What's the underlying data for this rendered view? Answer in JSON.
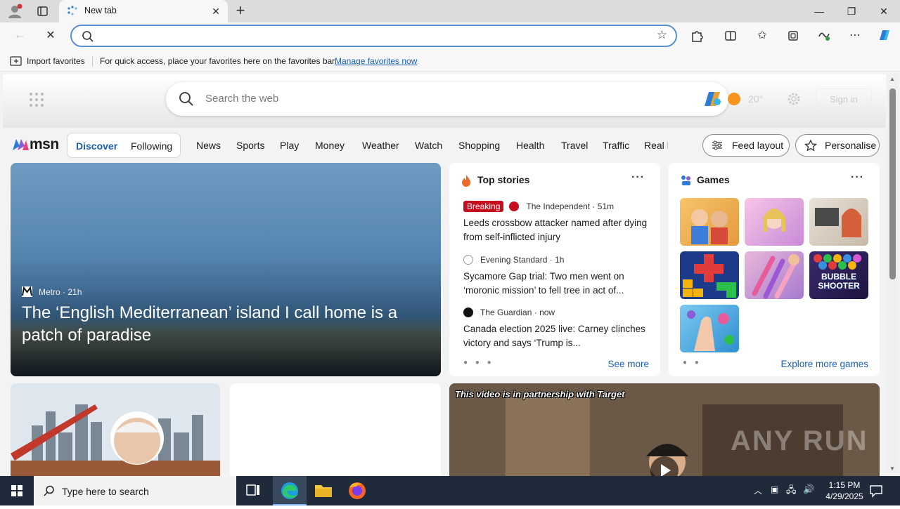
{
  "browser": {
    "tab_title": "New tab",
    "address_value": "",
    "favorites_bar": {
      "import_label": "Import favorites",
      "message": "For quick access, place your favorites here on the favorites bar.",
      "manage_link": "Manage favorites now"
    }
  },
  "newtab": {
    "search_placeholder": "Search the web",
    "weather_temp": "20°",
    "signin_label": "Sign in"
  },
  "msn": {
    "logo_text": "msn",
    "segments": {
      "discover": "Discover",
      "following": "Following"
    },
    "nav_links": [
      "News",
      "Sports",
      "Play",
      "Money",
      "Weather",
      "Watch",
      "Shopping",
      "Health",
      "Travel",
      "Traffic",
      "Real E"
    ],
    "feed_layout_label": "Feed layout",
    "personalise_label": "Personalise"
  },
  "hero": {
    "source": "Metro",
    "age": "21h",
    "title": "The ‘English Mediterranean’ island I call home is a patch of paradise"
  },
  "top_stories": {
    "heading": "Top stories",
    "stories": [
      {
        "badge": "Breaking",
        "source": "The Independent",
        "age": "51m",
        "title": "Leeds crossbow attacker named after dying from self-inflicted injury"
      },
      {
        "badge": "",
        "source": "Evening Standard",
        "age": "1h",
        "title": "Sycamore Gap trial: Two men went on ‘moronic mission’ to fell tree in act of..."
      },
      {
        "badge": "",
        "source": "The Guardian",
        "age": "now",
        "title": "Canada election 2025 live: Carney clinches victory and says ‘Trump is..."
      }
    ],
    "link_label": "See more"
  },
  "games": {
    "heading": "Games",
    "bubble_shooter_text": "BUBBLE SHOOTER",
    "link_label": "Explore more games"
  },
  "video": {
    "caption": "This video is in partnership with Target",
    "watermark": "ANY RUN"
  },
  "taskbar": {
    "search_label": "Type here to search",
    "time": "1:15 PM",
    "date": "4/29/2025"
  },
  "colors": {
    "accent": "#1a5fb4",
    "breaking": "#c50f1f",
    "taskbar": "#1f2b3a"
  }
}
